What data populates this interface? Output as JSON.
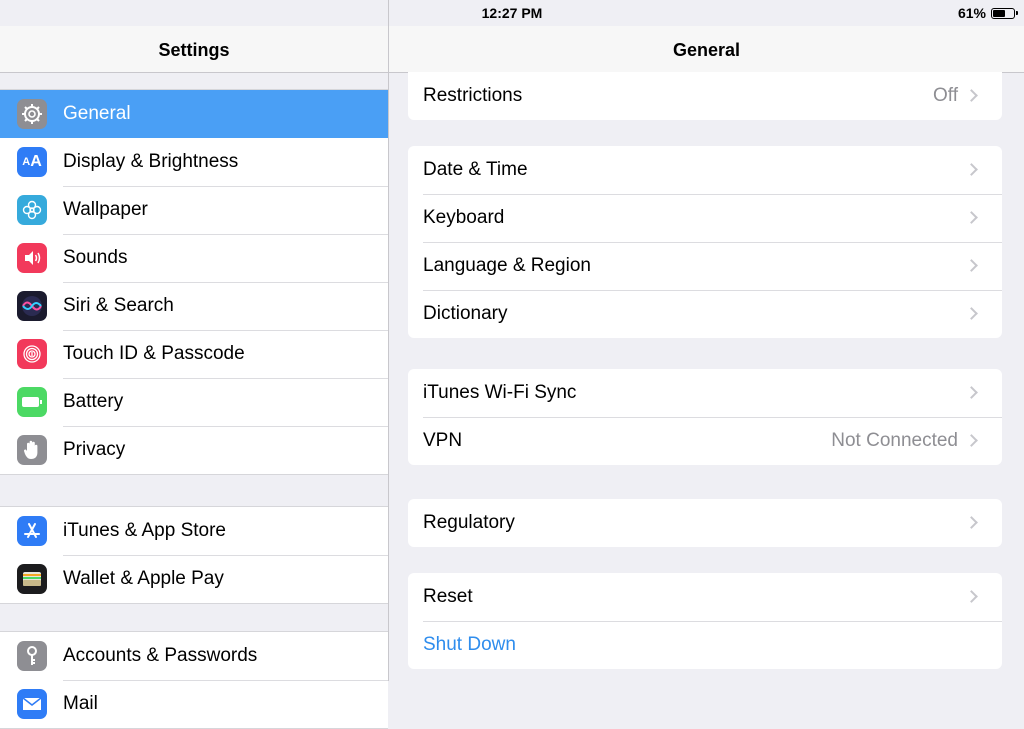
{
  "status_bar": {
    "device": "iPad",
    "time": "12:27 PM",
    "battery": "61%"
  },
  "master": {
    "title": "Settings",
    "groups": [
      [
        {
          "label": "General",
          "icon": "gear-icon",
          "color": "#8e8e93",
          "selected": true
        },
        {
          "label": "Display & Brightness",
          "icon": "text-size-icon",
          "color": "#2f7cf6"
        },
        {
          "label": "Wallpaper",
          "icon": "flower-icon",
          "color": "#36aadc"
        },
        {
          "label": "Sounds",
          "icon": "speaker-icon",
          "color": "#f2395b"
        },
        {
          "label": "Siri & Search",
          "icon": "siri-icon",
          "color": "#1b1b2e"
        },
        {
          "label": "Touch ID & Passcode",
          "icon": "fingerprint-icon",
          "color": "#f2395b"
        },
        {
          "label": "Battery",
          "icon": "battery-icon",
          "color": "#4cd964"
        },
        {
          "label": "Privacy",
          "icon": "hand-icon",
          "color": "#8e8e93"
        }
      ],
      [
        {
          "label": "iTunes & App Store",
          "icon": "app-store-icon",
          "color": "#2f7cf6"
        },
        {
          "label": "Wallet & Apple Pay",
          "icon": "wallet-icon",
          "color": "#1c1c1e"
        }
      ],
      [
        {
          "label": "Accounts & Passwords",
          "icon": "key-icon",
          "color": "#8e8e93"
        },
        {
          "label": "Mail",
          "icon": "mail-icon",
          "color": "#2f7cf6"
        }
      ]
    ]
  },
  "detail": {
    "title": "General",
    "groups": [
      [
        {
          "label": "Restrictions",
          "value": "Off"
        }
      ],
      [
        {
          "label": "Date & Time"
        },
        {
          "label": "Keyboard"
        },
        {
          "label": "Language & Region"
        },
        {
          "label": "Dictionary"
        }
      ],
      [
        {
          "label": "iTunes Wi-Fi Sync"
        },
        {
          "label": "VPN",
          "value": "Not Connected"
        }
      ],
      [
        {
          "label": "Regulatory"
        }
      ],
      [
        {
          "label": "Reset"
        },
        {
          "label": "Shut Down",
          "link": true
        }
      ]
    ]
  }
}
